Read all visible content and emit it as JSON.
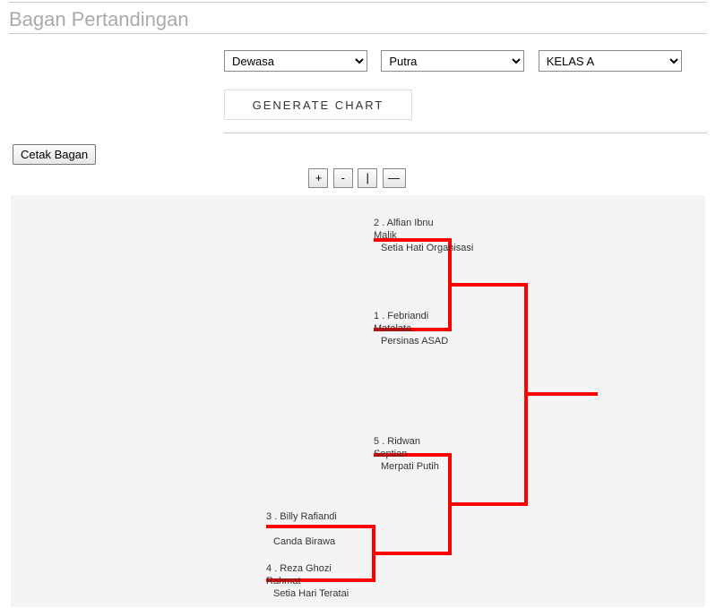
{
  "page_title": "Bagan Pertandingan",
  "filters": {
    "age_group": {
      "selected": "Dewasa",
      "options": [
        "Dewasa"
      ]
    },
    "gender": {
      "selected": "Putra",
      "options": [
        "Putra"
      ]
    },
    "class": {
      "selected": "KELAS A",
      "options": [
        "KELAS A"
      ]
    }
  },
  "generate_label": "GENERATE CHART",
  "print_label": "Cetak Bagan",
  "toolbar": {
    "zoom_in": "+",
    "zoom_out": "-",
    "info": "|",
    "collapse": "—"
  },
  "entrants": [
    {
      "seed": "2",
      "name_line": "2 . Alfian Ibnu",
      "name_cut": "Malik",
      "club": "Setia Hati Organisasi"
    },
    {
      "seed": "1",
      "name_line": "1 . Febriandi",
      "name_cut": "Matalata",
      "club": "Persinas ASAD"
    },
    {
      "seed": "5",
      "name_line": "5 . Ridwan",
      "name_cut": "Septian",
      "club": "Merpati Putih"
    },
    {
      "seed": "3",
      "name_line": "3 . Billy Rafiandi",
      "name_cut": "",
      "club": "Canda Birawa"
    },
    {
      "seed": "4",
      "name_line": "4 . Reza Ghozi",
      "name_cut": "Rahmat",
      "club": "Setia Hari Teratai"
    }
  ],
  "bracket_lines": {
    "color": "#ff0000",
    "stroke": 4
  }
}
